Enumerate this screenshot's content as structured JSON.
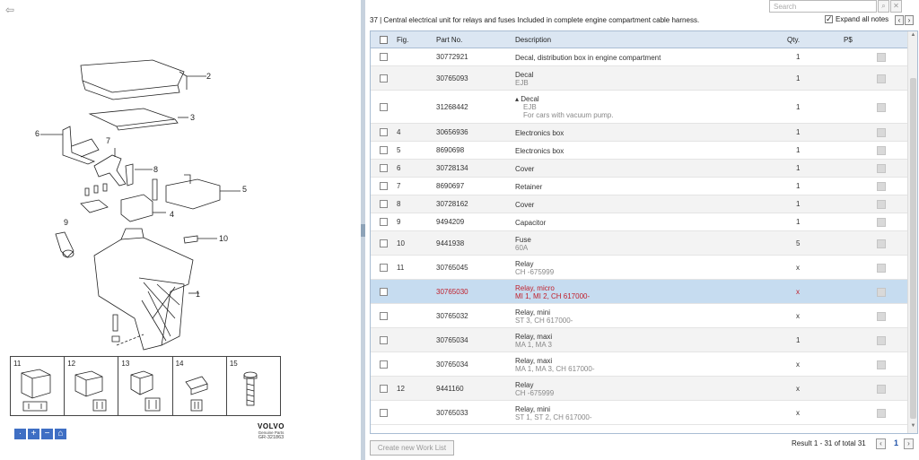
{
  "diagram": {
    "callouts": [
      "2",
      "3",
      "6",
      "7",
      "8",
      "5",
      "4",
      "9",
      "10",
      "1"
    ],
    "thumbnails": [
      "11",
      "12",
      "13",
      "14",
      "15"
    ],
    "brand": "VOLVO",
    "brand_sub": "Genuine Parts",
    "figure_code": "GR-321863",
    "tools": [
      "·",
      "+",
      "−",
      "⌂"
    ]
  },
  "toolbar": {
    "search_placeholder": "Search",
    "search_icon": "search-icon",
    "clear_icon": "close-icon"
  },
  "header": {
    "section": "37  |  Central electrical unit for relays and fuses Included in complete engine compartment cable harness.",
    "expand_label": "Expand all notes",
    "expand_checked": true
  },
  "grid": {
    "columns": {
      "fig": "Fig.",
      "part": "Part No.",
      "desc": "Description",
      "qty": "Qty.",
      "ps": "P$"
    },
    "rows": [
      {
        "fig": "",
        "part": "30772921",
        "desc": "Decal, distribution box in engine compartment",
        "sub": "",
        "sub2": "",
        "qty": "1"
      },
      {
        "fig": "",
        "part": "30765093",
        "desc": "Decal",
        "sub": "EJB",
        "sub2": "",
        "qty": "1"
      },
      {
        "fig": "",
        "part": "31268442",
        "desc": "▴ Decal",
        "sub": "EJB",
        "sub2": "For cars with vacuum pump.",
        "qty": "1"
      },
      {
        "fig": "4",
        "part": "30656936",
        "desc": "Electronics box",
        "sub": "",
        "sub2": "",
        "qty": "1"
      },
      {
        "fig": "5",
        "part": "8690698",
        "desc": "Electronics box",
        "sub": "",
        "sub2": "",
        "qty": "1"
      },
      {
        "fig": "6",
        "part": "30728134",
        "desc": "Cover",
        "sub": "",
        "sub2": "",
        "qty": "1"
      },
      {
        "fig": "7",
        "part": "8690697",
        "desc": "Retainer",
        "sub": "",
        "sub2": "",
        "qty": "1"
      },
      {
        "fig": "8",
        "part": "30728162",
        "desc": "Cover",
        "sub": "",
        "sub2": "",
        "qty": "1"
      },
      {
        "fig": "9",
        "part": "9494209",
        "desc": "Capacitor",
        "sub": "",
        "sub2": "",
        "qty": "1"
      },
      {
        "fig": "10",
        "part": "9441938",
        "desc": "Fuse",
        "sub": "60A",
        "sub2": "",
        "qty": "5"
      },
      {
        "fig": "11",
        "part": "30765045",
        "desc": "Relay",
        "sub": "CH -675999",
        "sub2": "",
        "qty": "x"
      },
      {
        "fig": "",
        "part": "30765030",
        "desc": "Relay, micro",
        "sub": "MI 1, MI 2, CH 617000-",
        "sub2": "",
        "qty": "x",
        "selected": true
      },
      {
        "fig": "",
        "part": "30765032",
        "desc": "Relay, mini",
        "sub": "ST 3, CH 617000-",
        "sub2": "",
        "qty": "x"
      },
      {
        "fig": "",
        "part": "30765034",
        "desc": "Relay, maxi",
        "sub": "MA 1, MA 3",
        "sub2": "",
        "qty": "1"
      },
      {
        "fig": "",
        "part": "30765034",
        "desc": "Relay, maxi",
        "sub": "MA 1, MA 3, CH 617000-",
        "sub2": "",
        "qty": "x"
      },
      {
        "fig": "12",
        "part": "9441160",
        "desc": "Relay",
        "sub": "CH -675999",
        "sub2": "",
        "qty": "x"
      },
      {
        "fig": "",
        "part": "30765033",
        "desc": "Relay, mini",
        "sub": "ST 1, ST 2, CH 617000-",
        "sub2": "",
        "qty": "x"
      }
    ]
  },
  "footer": {
    "worklist_label": "Create new Work List",
    "result_text": "Result 1 - 31 of total 31",
    "page": "1"
  },
  "colors": {
    "header_bg": "#dbe6f2",
    "selected_bg": "#c6dcf0",
    "selected_text": "#c0202c",
    "tool_blue": "#3f6fc4"
  }
}
